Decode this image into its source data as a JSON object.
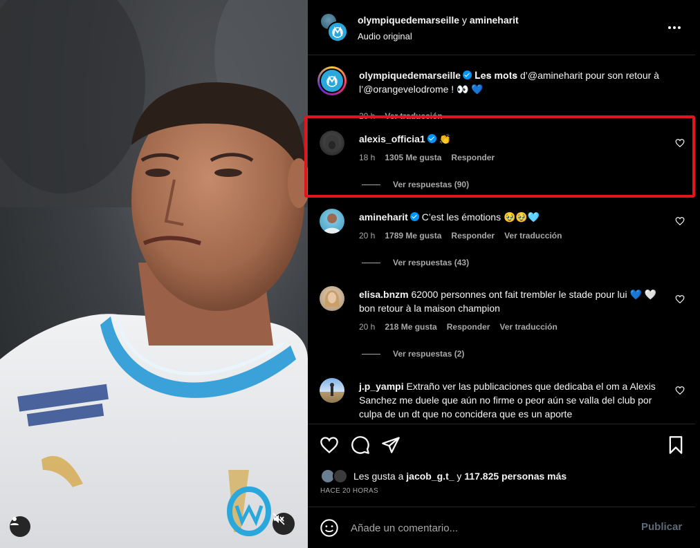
{
  "header": {
    "account1": "olympiquedemarseille",
    "joiner": "y",
    "account2": "amineharit",
    "audio": "Audio original",
    "more_icon": "more-horizontal-icon"
  },
  "caption": {
    "user": "olympiquedemarseille",
    "text_prefix": "𝐋𝐞𝐬 𝐦𝐨𝐭𝐬 d’@amineharit pour son retour à l’@orangevelodrome ! ",
    "emoji": "👀 💙",
    "time": "20 h",
    "translate": "Ver traducción"
  },
  "comments": [
    {
      "user": "alexis_officia1",
      "text": "👏",
      "time": "18 h",
      "likes": "1305 Me gusta",
      "reply": "Responder",
      "replies": "Ver respuestas (90)"
    },
    {
      "user": "amineharit",
      "text": "C’est les émotions 🥹🥹🩵",
      "time": "20 h",
      "likes": "1789 Me gusta",
      "reply": "Responder",
      "translate": "Ver traducción",
      "replies": "Ver respuestas (43)"
    },
    {
      "user": "elisa.bnzm",
      "text": "62000 personnes ont fait trembler le stade pour lui 💙 🤍 bon retour à la maison champion",
      "time": "20 h",
      "likes": "218 Me gusta",
      "reply": "Responder",
      "translate": "Ver traducción",
      "replies": "Ver respuestas (2)"
    },
    {
      "user": "j.p_yampi",
      "text": "Extraño ver las publicaciones que dedicaba el om a Alexis Sanchez me duele que aún no firme o peor aún se valla del club por culpa de un dt que no concidera que es un aporte"
    }
  ],
  "actions": {
    "likes_prefix": "Les gusta a",
    "liker": "jacob_g.t_",
    "likes_joiner": "y",
    "likes_count": "117.825 personas más",
    "time_ago": "HACE 20 HORAS"
  },
  "composer": {
    "placeholder": "Añade un comentario...",
    "publish": "Publicar"
  },
  "colors": {
    "highlight": "#e0161d",
    "verified": "#0095f6",
    "om_blue": "#2aa8dc"
  }
}
